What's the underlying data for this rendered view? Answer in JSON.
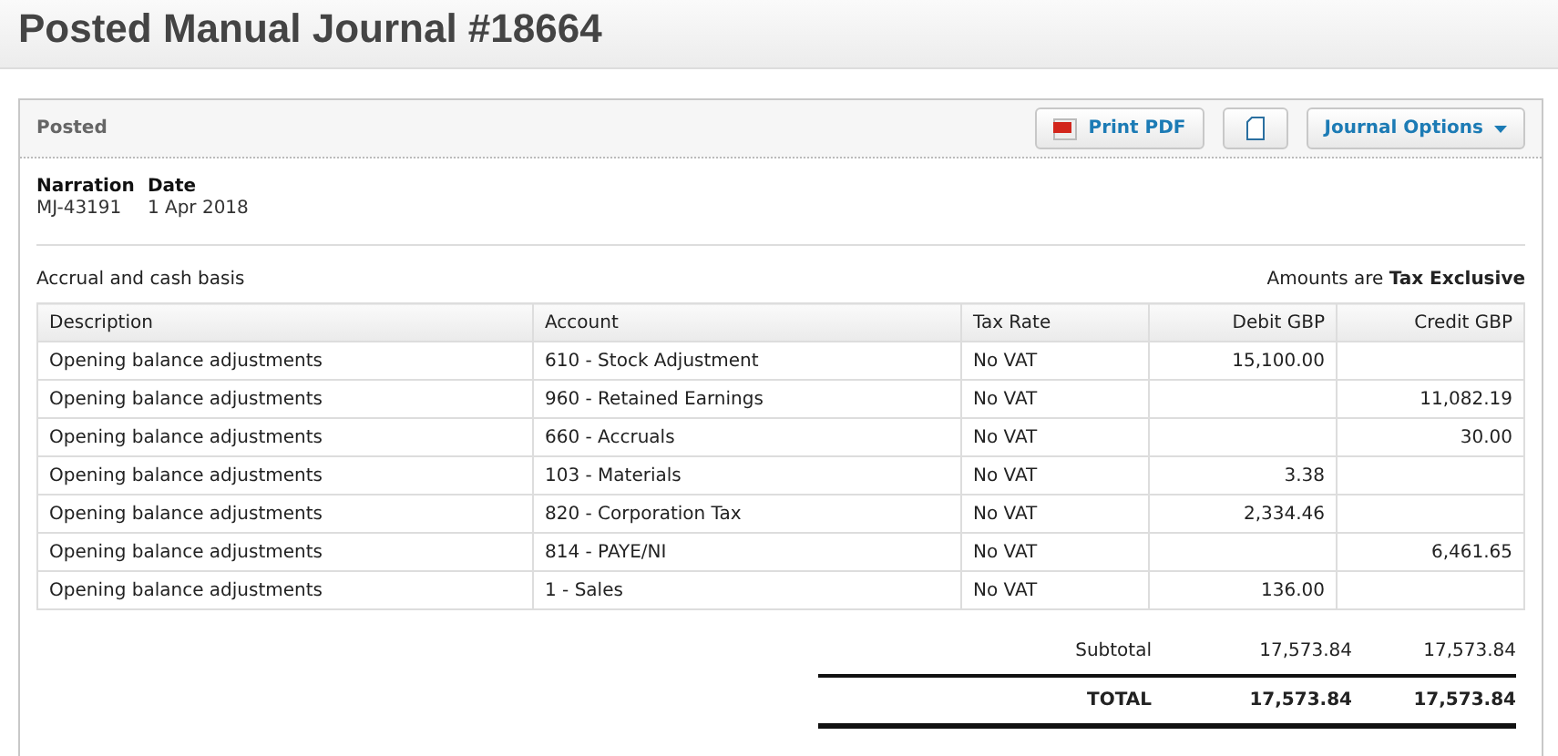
{
  "title": "Posted Manual Journal #18664",
  "panel": {
    "status": "Posted",
    "buttons": [
      {
        "kind": "pdf",
        "label": "Print PDF"
      },
      {
        "kind": "copy"
      },
      {
        "kind": "menu",
        "label": "Journal Options"
      }
    ]
  },
  "details": [
    {
      "label": "Narration",
      "value": "MJ-43191"
    },
    {
      "label": "Date",
      "value": "1 Apr 2018"
    }
  ],
  "basis": "Accrual and cash basis",
  "amounts_note": "Amounts are **Tax Exclusive**",
  "table": {
    "columns": [
      {
        "label": "Description",
        "kind": "text"
      },
      {
        "label": "Account",
        "kind": "text"
      },
      {
        "label": "Tax Rate",
        "kind": "text"
      },
      {
        "label": "Debit GBP",
        "kind": "amount"
      },
      {
        "label": "Credit GBP",
        "kind": "amount"
      }
    ],
    "rows": [
      [
        "Opening balance adjustments",
        "610 - Stock Adjustment",
        "No VAT",
        "15,100.00",
        ""
      ],
      [
        "Opening balance adjustments",
        "960 - Retained Earnings",
        "No VAT",
        "",
        "11,082.19"
      ],
      [
        "Opening balance adjustments",
        "660 - Accruals",
        "No VAT",
        "",
        "30.00"
      ],
      [
        "Opening balance adjustments",
        "103 - Materials",
        "No VAT",
        "3.38",
        ""
      ],
      [
        "Opening balance adjustments",
        "820 - Corporation Tax",
        "No VAT",
        "2,334.46",
        ""
      ],
      [
        "Opening balance adjustments",
        "814 - PAYE/NI",
        "No VAT",
        "",
        "6,461.65"
      ],
      [
        "Opening balance adjustments",
        "1 - Sales",
        "No VAT",
        "136.00",
        ""
      ]
    ]
  },
  "totals": [
    {
      "kind": "subtotal",
      "label": "Subtotal",
      "debit": "17,573.84",
      "credit": "17,573.84"
    },
    {
      "kind": "total",
      "label": "TOTAL",
      "debit": "17,573.84",
      "credit": "17,573.84"
    }
  ]
}
